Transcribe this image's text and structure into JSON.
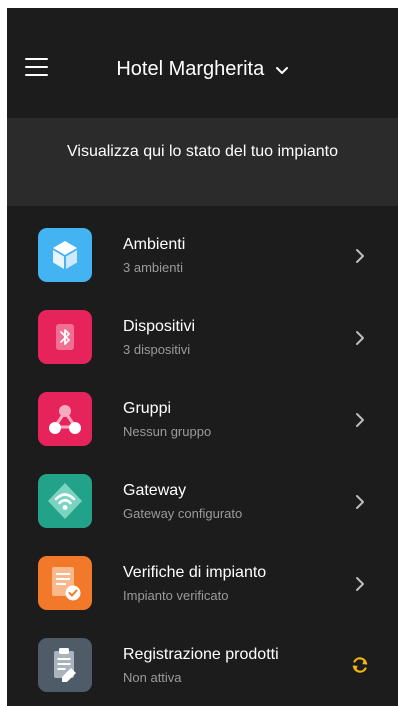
{
  "header": {
    "title": "Hotel Margherita",
    "menu_icon": "hamburger-menu-icon",
    "dropdown_icon": "chevron-down-icon"
  },
  "banner": {
    "text": "Visualizza qui lo stato del tuo impianto"
  },
  "items": [
    {
      "title": "Ambienti",
      "subtitle": "3 ambienti",
      "icon": "cube-icon",
      "color": "#43b3f2",
      "action": "chevron-right-icon"
    },
    {
      "title": "Dispositivi",
      "subtitle": "3 dispositivi",
      "icon": "bluetooth-icon",
      "color": "#e6235a",
      "action": "chevron-right-icon"
    },
    {
      "title": "Gruppi",
      "subtitle": "Nessun gruppo",
      "icon": "group-icon",
      "color": "#e6235a",
      "action": "chevron-right-icon"
    },
    {
      "title": "Gateway",
      "subtitle": "Gateway configurato",
      "icon": "wifi-icon",
      "color": "#22a389",
      "action": "chevron-right-icon"
    },
    {
      "title": "Verifiche di impianto",
      "subtitle": "Impianto verificato",
      "icon": "checklist-icon",
      "color": "#f2792a",
      "action": "chevron-right-icon"
    },
    {
      "title": "Registrazione prodotti",
      "subtitle": "Non attiva",
      "icon": "clipboard-edit-icon",
      "color": "#4f5b66",
      "action": "sync-icon"
    }
  ],
  "colors": {
    "background": "#1c1c1c",
    "banner": "#2b2b2b",
    "sync_accent": "#f5b50b"
  }
}
